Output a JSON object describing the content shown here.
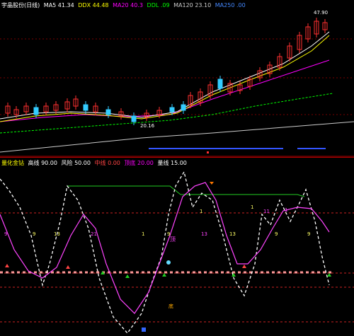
{
  "main_legend": {
    "title": "宇晶股份(日线)",
    "items": [
      {
        "label": "MA5 41.34",
        "color": "#ffffff"
      },
      {
        "label": "DDX 44.48",
        "color": "#ffff00"
      },
      {
        "label": "MA20 40.3",
        "color": "#ff00ff"
      },
      {
        "label": "DDL .09",
        "color": "#00ff00"
      },
      {
        "label": "MA120 23.10",
        "color": "#cccccc"
      },
      {
        "label": "MA250 .00",
        "color": "#4488ff"
      }
    ]
  },
  "main_price_labels": {
    "high": "47.90",
    "low": "20.16"
  },
  "sub_legend": {
    "title": "量化金钻",
    "items": [
      {
        "label": "高线 90.00",
        "color": "#ffffff"
      },
      {
        "label": "风险 50.00",
        "color": "#ffffff"
      },
      {
        "label": "中线 0.00",
        "color": "#ff4444"
      },
      {
        "label": "顶底 20.00",
        "color": "#ff00ff"
      },
      {
        "label": "量线 15.00",
        "color": "#ffffff"
      }
    ]
  },
  "sub_markers": {
    "top_label": "顶",
    "bottom_label": "底",
    "numbers": [
      "9",
      "9",
      "13",
      "21",
      "1",
      "9",
      "13",
      "13",
      "9",
      "11",
      "1",
      "1",
      "1",
      "9"
    ]
  }
}
